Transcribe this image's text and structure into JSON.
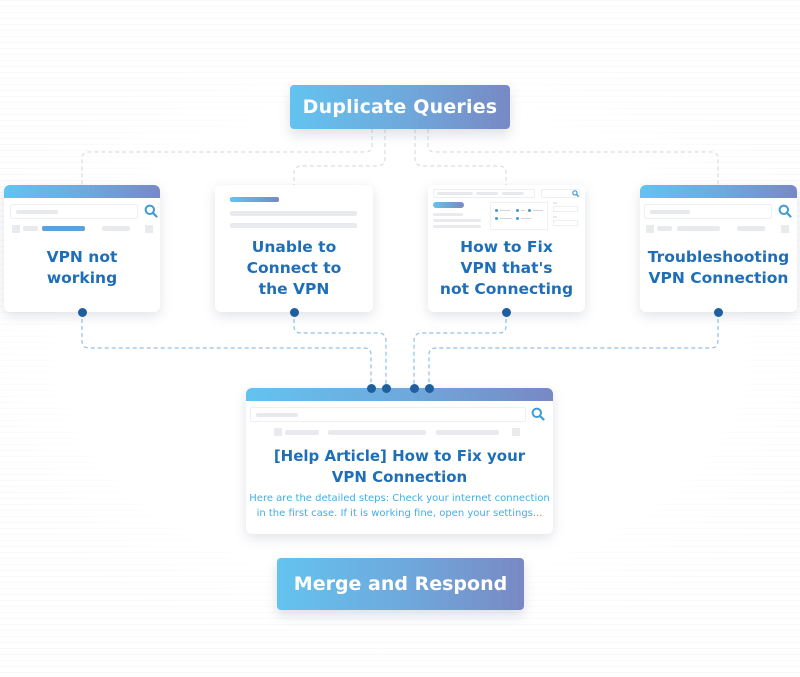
{
  "diagram": {
    "top_node": {
      "label": "Duplicate Queries"
    },
    "queries": [
      {
        "label_line1": "VPN not",
        "label_line2": "working",
        "style": "search-page"
      },
      {
        "label_line1": "Unable to",
        "label_line2": "Connect to",
        "label_line3": "the VPN",
        "style": "article-page"
      },
      {
        "label_line1": "How to Fix",
        "label_line2": "VPN that's",
        "label_line3": "not Connecting",
        "style": "form-page"
      },
      {
        "label_line1": "Troubleshooting",
        "label_line2": "VPN Connection",
        "style": "search-page"
      }
    ],
    "result_article": {
      "title_line1": "[Help Article] How to Fix your",
      "title_line2": "VPN Connection",
      "body_line1": "Here are the detailed steps: Check your internet connection",
      "body_line2": "in the first case. If it is working fine, open your settings..."
    },
    "bottom_node": {
      "label": "Merge and Respond"
    },
    "icons": {
      "search": "search-icon",
      "connector_dot": "node-dot"
    },
    "colors": {
      "gradient_start": "#63c3ef",
      "gradient_end": "#7889c4",
      "title_text": "#1f6fb8",
      "body_text": "#42aee6",
      "node_dot": "#1e5f9e",
      "connector_line": "#8fc0e8"
    }
  }
}
